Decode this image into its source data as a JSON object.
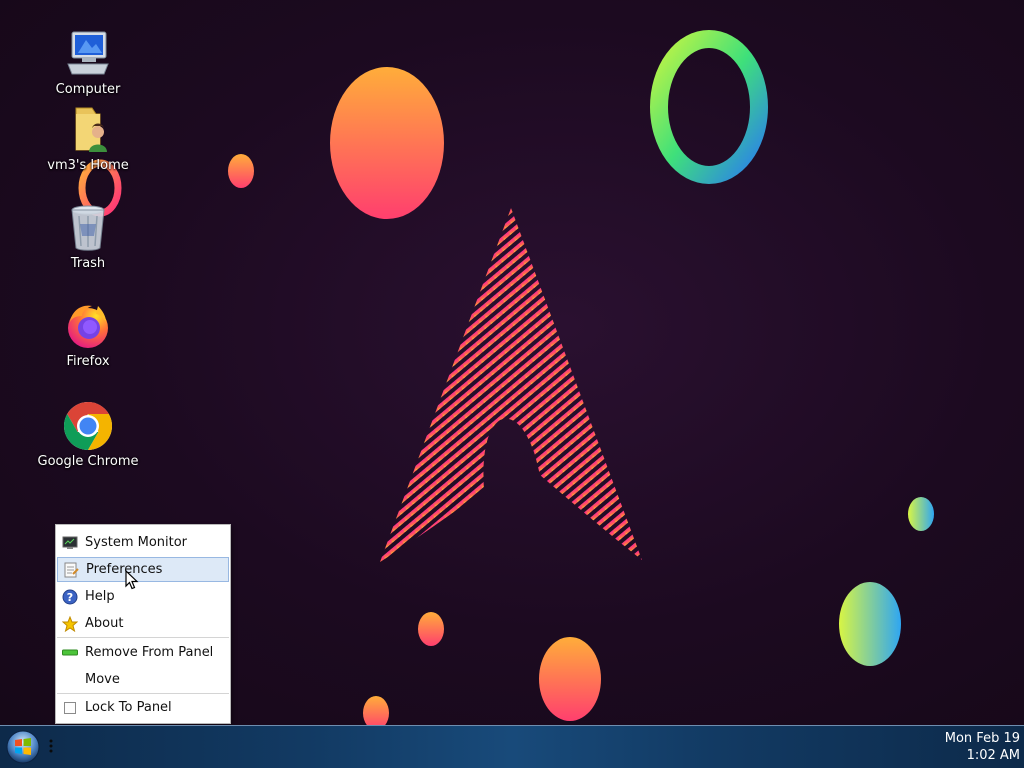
{
  "desktop": {
    "icons": [
      {
        "label": "Computer",
        "icon": "computer-icon"
      },
      {
        "label": "vm3's Home",
        "icon": "home-folder-icon"
      },
      {
        "label": "Trash",
        "icon": "trash-icon"
      },
      {
        "label": "Firefox",
        "icon": "firefox-icon"
      },
      {
        "label": "Google Chrome",
        "icon": "chrome-icon"
      }
    ]
  },
  "context_menu": {
    "items": [
      {
        "label": "System Monitor",
        "icon": "system-monitor-icon"
      },
      {
        "label": "Preferences",
        "icon": "preferences-icon",
        "highlighted": true
      },
      {
        "label": "Help",
        "icon": "help-icon"
      },
      {
        "label": "About",
        "icon": "about-star-icon"
      },
      {
        "label": "Remove From Panel",
        "icon": "remove-icon"
      },
      {
        "label": "Move"
      },
      {
        "label": "Lock To Panel",
        "checked": false
      }
    ]
  },
  "taskbar": {
    "clock": {
      "date": "Mon Feb 19",
      "time": "1:02 AM"
    }
  },
  "colors": {
    "desktop_bg": "#1e0b22",
    "menu_highlight": "#dde9f7",
    "taskbar": "#123a63"
  }
}
